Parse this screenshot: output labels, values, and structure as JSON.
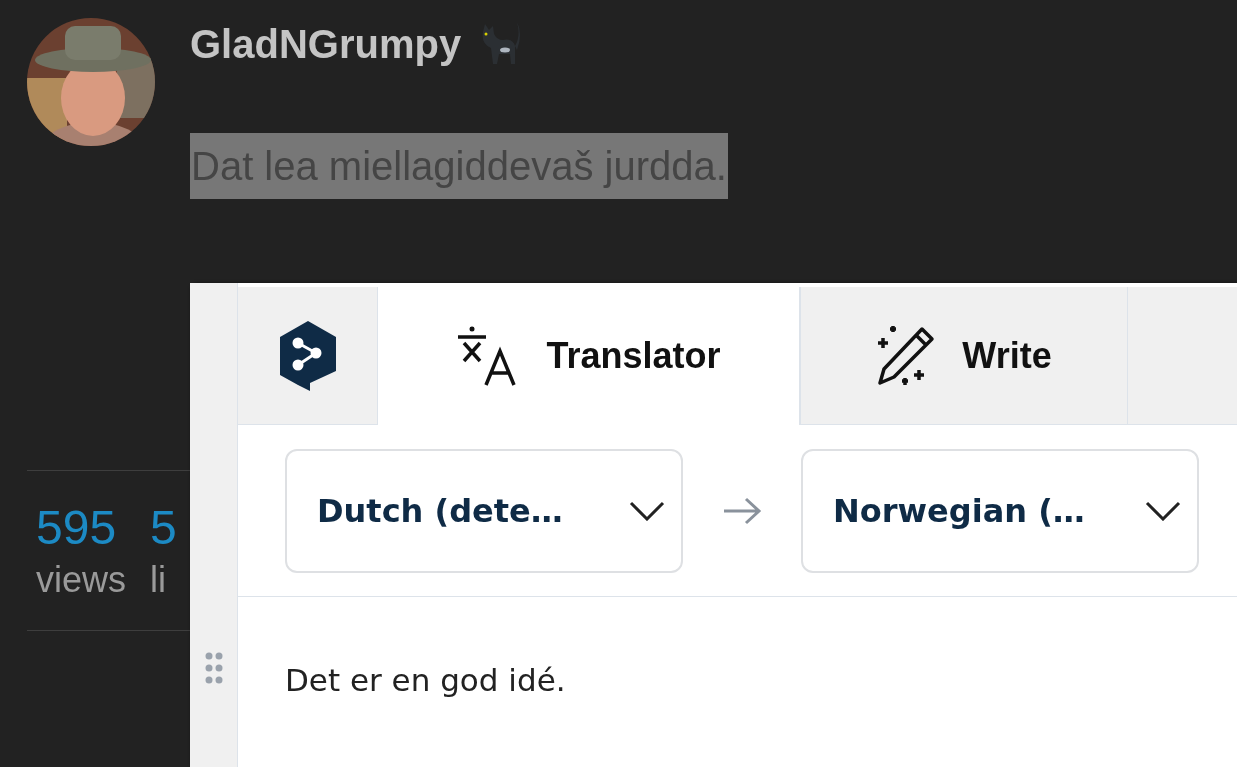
{
  "post": {
    "author": "GladNGrumpy",
    "text": "Dat lea miellagiddevaš jurdda.",
    "text_selected": true
  },
  "stats": [
    {
      "value": "595",
      "label": "views"
    },
    {
      "value": "5",
      "label": "li"
    }
  ],
  "translator": {
    "tabs": [
      {
        "kind": "translate",
        "label": "Translator",
        "selected": true
      },
      {
        "kind": "write",
        "label": "Write",
        "selected": false
      }
    ],
    "source_language": "Dutch (dete…",
    "target_language": "Norwegian (…",
    "output": "Det er en god idé."
  }
}
